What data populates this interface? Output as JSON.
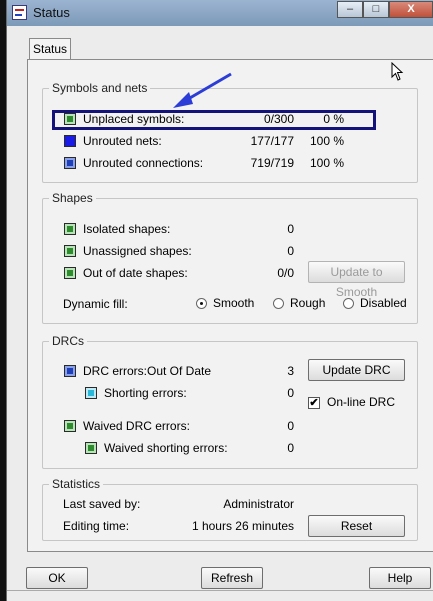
{
  "window": {
    "title": "Status",
    "minimize": "–",
    "maximize": "□",
    "close": "X"
  },
  "tab": {
    "label": "Status"
  },
  "symbols": {
    "legend": "Symbols and nets",
    "rows": [
      {
        "label": "Unplaced symbols:",
        "count": "0/300",
        "pct": "0 %",
        "color": "#2e8b2e"
      },
      {
        "label": "Unrouted nets:",
        "count": "177/177",
        "pct": "100 %",
        "color": "#1a1ae6"
      },
      {
        "label": "Unrouted connections:",
        "count": "719/719",
        "pct": "100 %",
        "color": "#1f3fb8"
      }
    ]
  },
  "shapes": {
    "legend": "Shapes",
    "rows": [
      {
        "label": "Isolated shapes:",
        "value": "0"
      },
      {
        "label": "Unassigned shapes:",
        "value": "0"
      },
      {
        "label": "Out of date shapes:",
        "value": "0/0"
      }
    ],
    "update_button": "Update to Smooth",
    "dynamic_fill_label": "Dynamic fill:",
    "fill_options": [
      "Smooth",
      "Rough",
      "Disabled"
    ],
    "fill_selected": "Smooth"
  },
  "drcs": {
    "legend": "DRCs",
    "drc_label": "DRC errors:",
    "drc_status": "Out Of Date",
    "drc_value": "3",
    "shorting_label": "Shorting errors:",
    "shorting_value": "0",
    "waived_label": "Waived DRC errors:",
    "waived_value": "0",
    "waived_shorting_label": "Waived shorting errors:",
    "waived_shorting_value": "0",
    "update_button": "Update DRC",
    "online_label": "On-line DRC",
    "online_checked": true
  },
  "statistics": {
    "legend": "Statistics",
    "saved_label": "Last saved by:",
    "saved_value": "Administrator",
    "editing_label": "Editing time:",
    "editing_value": "1 hours 26 minutes",
    "reset_button": "Reset"
  },
  "footer": {
    "ok": "OK",
    "refresh": "Refresh",
    "help": "Help"
  }
}
